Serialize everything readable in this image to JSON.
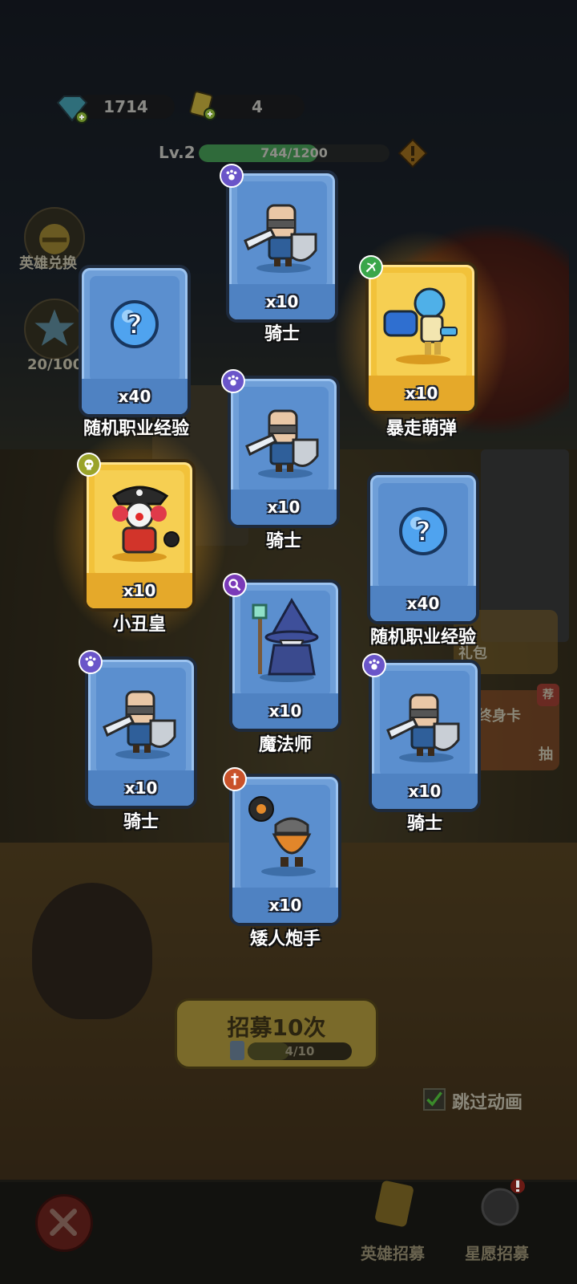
{
  "hud": {
    "gems": "1714",
    "tickets": "4",
    "level_label": "Lv.2",
    "xp_text": "744/1200",
    "xp_fraction": 0.62
  },
  "side": {
    "hero_exchange_label": "英雄兑换",
    "stars_progress": "20/100"
  },
  "cards": [
    {
      "name": "骑士",
      "count": "x10",
      "rarity": "blue",
      "class": "paw",
      "art": "knight"
    },
    {
      "name": "随机职业经验",
      "count": "x40",
      "rarity": "blue",
      "class": "none",
      "art": "question"
    },
    {
      "name": "暴走萌弹",
      "count": "x10",
      "rarity": "gold",
      "class": "bow",
      "art": "gunner"
    },
    {
      "name": "骑士",
      "count": "x10",
      "rarity": "blue",
      "class": "paw",
      "art": "knight"
    },
    {
      "name": "小丑皇",
      "count": "x10",
      "rarity": "gold",
      "class": "skull",
      "art": "clown"
    },
    {
      "name": "随机职业经验",
      "count": "x40",
      "rarity": "blue",
      "class": "none",
      "art": "question"
    },
    {
      "name": "魔法师",
      "count": "x10",
      "rarity": "blue",
      "class": "wand",
      "art": "wizard"
    },
    {
      "name": "骑士",
      "count": "x10",
      "rarity": "blue",
      "class": "paw",
      "art": "knight"
    },
    {
      "name": "骑士",
      "count": "x10",
      "rarity": "blue",
      "class": "paw",
      "art": "knight"
    },
    {
      "name": "矮人炮手",
      "count": "x10",
      "rarity": "blue",
      "class": "dagger",
      "art": "dwarf"
    }
  ],
  "recruit": {
    "label": "招募10次",
    "progress_text": "4/10",
    "progress_fraction": 0.4
  },
  "skip": {
    "label": "跳过动画",
    "checked": true
  },
  "nav": {
    "hero_recruit": "英雄招募",
    "wish_recruit": "星愿招募"
  },
  "shop": {
    "gift_label": "礼包",
    "card_label": "终身卡",
    "card_badge": "荐",
    "card_sub": "抽"
  },
  "colors": {
    "card_blue": "#6f9fd8",
    "card_gold": "#f2c23a",
    "xp_green": "#2f6a3a"
  }
}
